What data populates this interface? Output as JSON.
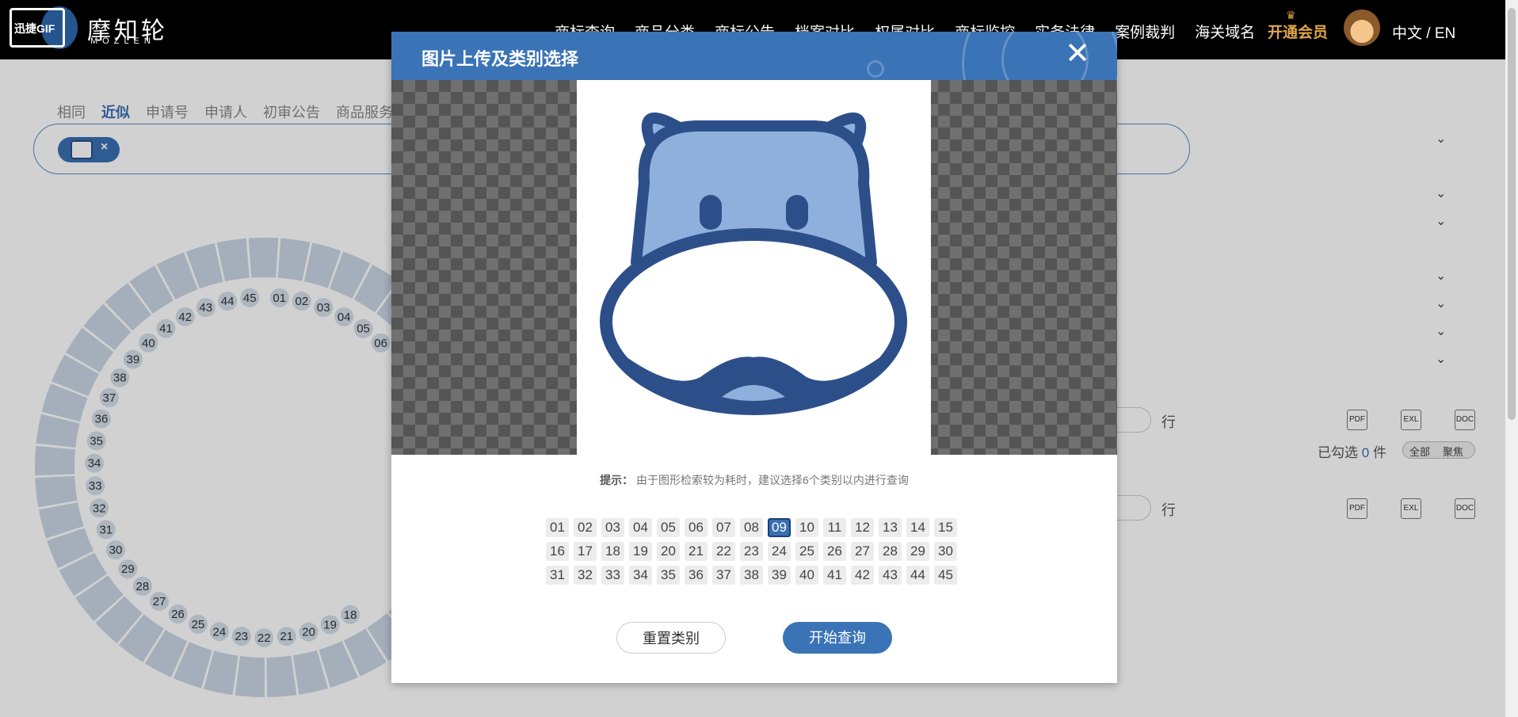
{
  "topbar": {
    "gif_badge": "迅捷GIF",
    "brand": "摩知轮",
    "brand_sub": "MOZLEN",
    "nav": [
      "商标查询",
      "商品分类",
      "商标公告",
      "档案对比",
      "权属对比",
      "商标监控",
      "实务法律",
      "案例裁判",
      "海关域名"
    ],
    "vip": "开通会员",
    "lang": "中文 / EN"
  },
  "background": {
    "tabs": [
      "相同",
      "近似",
      "申请号",
      "申请人",
      "初审公告",
      "商品服务"
    ],
    "active_tab": "近似",
    "chip_close": "×",
    "row_unit": "行",
    "selected_prefix": "已勾选",
    "selected_count": "0",
    "selected_suffix": "件",
    "toggle_all": "全部",
    "toggle_focus": "聚焦",
    "file_labels": [
      "PDF",
      "EXL",
      "DOC"
    ],
    "wheel_numbers": [
      "45",
      "01",
      "02",
      "03",
      "04",
      "05",
      "06",
      "44",
      "43",
      "42",
      "41",
      "40",
      "39",
      "38",
      "37",
      "36",
      "35",
      "34",
      "33",
      "32",
      "31",
      "30",
      "29",
      "28",
      "27",
      "26",
      "25",
      "24",
      "23",
      "22",
      "21",
      "20",
      "19",
      "18"
    ]
  },
  "modal": {
    "title": "图片上传及类别选择",
    "close": "✕",
    "tip_label": "提示：",
    "tip_text": "由于图形检索较为耗时，建议选择6个类别以内进行查询",
    "categories": [
      [
        "01",
        "02",
        "03",
        "04",
        "05",
        "06",
        "07",
        "08",
        "09",
        "10",
        "11",
        "12",
        "13",
        "14",
        "15"
      ],
      [
        "16",
        "17",
        "18",
        "19",
        "20",
        "21",
        "22",
        "23",
        "24",
        "25",
        "26",
        "27",
        "28",
        "29",
        "30"
      ],
      [
        "31",
        "32",
        "33",
        "34",
        "35",
        "36",
        "37",
        "38",
        "39",
        "40",
        "41",
        "42",
        "43",
        "44",
        "45"
      ]
    ],
    "selected_category": "09",
    "reset_label": "重置类别",
    "search_label": "开始查询"
  },
  "colors": {
    "accent": "#3a73b6",
    "vip": "#e0a54a",
    "hippo_dark": "#2c4f8a",
    "hippo_light": "#8fb0dc"
  }
}
